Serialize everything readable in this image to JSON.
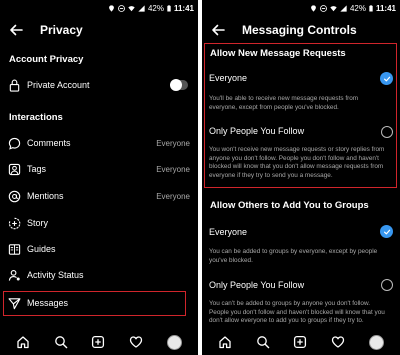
{
  "status": {
    "battery": "42%",
    "time": "11:41"
  },
  "left": {
    "title": "Privacy",
    "account_header": "Account Privacy",
    "private_account_label": "Private Account",
    "interactions_header": "Interactions",
    "items": [
      {
        "label": "Comments",
        "value": "Everyone",
        "icon": "comment-icon"
      },
      {
        "label": "Tags",
        "value": "Everyone",
        "icon": "tag-icon"
      },
      {
        "label": "Mentions",
        "value": "Everyone",
        "icon": "mention-icon"
      },
      {
        "label": "Story",
        "value": "",
        "icon": "story-icon"
      },
      {
        "label": "Guides",
        "value": "",
        "icon": "guides-icon"
      },
      {
        "label": "Activity Status",
        "value": "",
        "icon": "activity-icon"
      },
      {
        "label": "Messages",
        "value": "",
        "icon": "messages-icon"
      }
    ]
  },
  "right": {
    "title": "Messaging Controls",
    "requests_header": "Allow New Message Requests",
    "req_everyone_label": "Everyone",
    "req_everyone_desc": "You'll be able to receive new message requests from everyone, except from people you've blocked.",
    "req_follow_label": "Only People You Follow",
    "req_follow_desc": "You won't receive new message requests or story replies from anyone you don't follow. People you don't follow and haven't blocked will know that you don't allow message requests from everyone if they try to send you a message.",
    "groups_header": "Allow Others to Add You to Groups",
    "grp_everyone_label": "Everyone",
    "grp_everyone_desc": "You can be added to groups by everyone, except by people you've blocked.",
    "grp_follow_label": "Only People You Follow",
    "grp_follow_desc": "You can't be added to groups by anyone you don't follow. People you don't follow and haven't blocked will know that you don't allow everyone to add you to groups if they try to."
  },
  "colors": {
    "accent": "#3897f0",
    "highlight": "#d0252b",
    "background": "#000000"
  }
}
